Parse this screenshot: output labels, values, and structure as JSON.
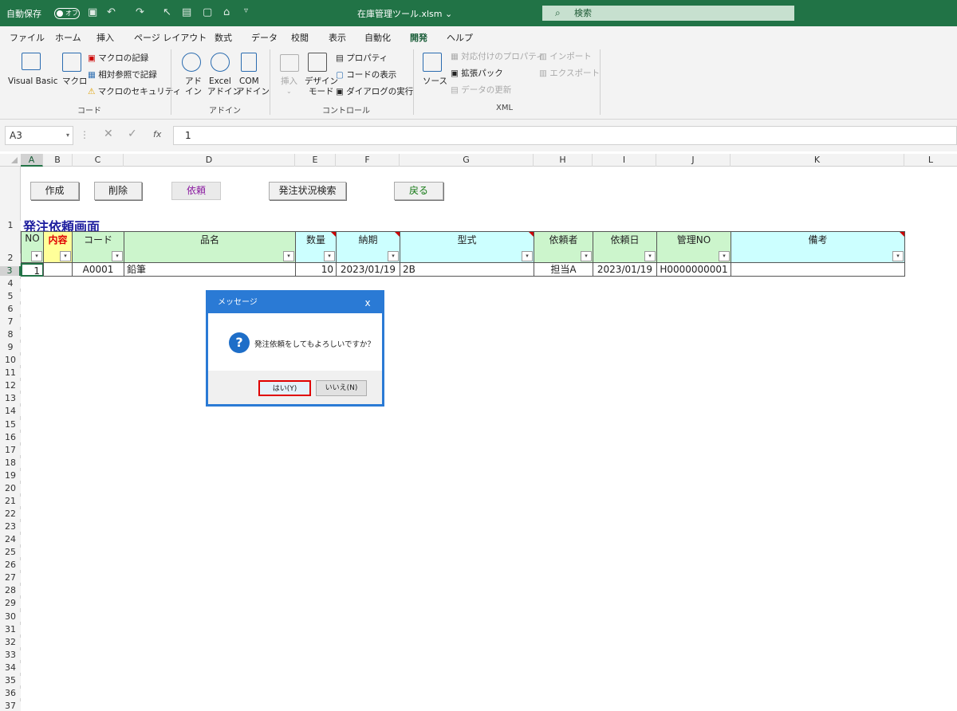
{
  "titlebar": {
    "autosave_label": "自動保存",
    "toggle_state": "オフ",
    "filename": "在庫管理ツール.xlsm",
    "search_placeholder": "検索"
  },
  "menu": [
    "ファイル",
    "ホーム",
    "挿入",
    "ページ レイアウト",
    "数式",
    "データ",
    "校閲",
    "表示",
    "自動化",
    "開発",
    "ヘルプ"
  ],
  "ribbon": {
    "code": {
      "visual_basic": "Visual Basic",
      "macro": "マクロ",
      "record_macro": "マクロの記録",
      "relative_ref": "相対参照で記録",
      "macro_security": "マクロのセキュリティ",
      "group": "コード"
    },
    "addins": {
      "addin_top": "アド",
      "addin_bottom": "イン",
      "excel_top": "Excel",
      "excel_bottom": "アドイン",
      "com_top": "COM",
      "com_bottom": "アドイン",
      "group": "アドイン"
    },
    "controls": {
      "insert": "挿入",
      "design_top": "デザイン",
      "design_bottom": "モード",
      "properties": "プロパティ",
      "view_code": "コードの表示",
      "run_dialog": "ダイアログの実行",
      "group": "コントロール"
    },
    "xml": {
      "source": "ソース",
      "map_props": "対応付けのプロパティ",
      "ext_pack": "拡張パック",
      "refresh": "データの更新",
      "import": "インポート",
      "export": "エクスポート",
      "group": "XML"
    }
  },
  "formula_bar": {
    "name_box": "A3",
    "fx": "fx",
    "value": "1"
  },
  "columns": [
    "A",
    "B",
    "C",
    "D",
    "E",
    "F",
    "G",
    "H",
    "I",
    "J",
    "K",
    "L"
  ],
  "rows": [
    "1",
    "2",
    "3",
    "4",
    "5",
    "6",
    "7",
    "8",
    "9",
    "10",
    "11",
    "12",
    "13",
    "14",
    "15",
    "16",
    "17",
    "18",
    "19",
    "20",
    "21",
    "22",
    "23",
    "24",
    "25",
    "26",
    "27",
    "28",
    "29",
    "30",
    "31",
    "32",
    "33",
    "34",
    "35",
    "36",
    "37"
  ],
  "sheet_buttons": {
    "create": "作成",
    "delete": "削除",
    "request": "依頼",
    "status_search": "発注状況検索",
    "back": "戻る"
  },
  "sheet_title": "発注依頼画面",
  "headers": {
    "no": "NO",
    "content": "内容",
    "code": "コード",
    "item": "品名",
    "qty": "数量",
    "due": "納期",
    "model": "型式",
    "requester": "依頼者",
    "req_date": "依頼日",
    "mgmt_no": "管理NO",
    "remarks": "備考"
  },
  "filter_glyph": "▾",
  "row3": {
    "no": "1",
    "content": "",
    "code": "A0001",
    "item": "鉛筆",
    "qty": "10",
    "due": "2023/01/19",
    "model": "2B",
    "requester": "担当A",
    "req_date": "2023/01/19",
    "mgmt_no": "H0000000001",
    "remarks": ""
  },
  "dialog": {
    "title": "メッセージ",
    "close": "x",
    "icon": "?",
    "message": "発注依頼をしてもよろしいですか？",
    "yes": "はい(Y)",
    "no": "いいえ(N)"
  },
  "colors": {
    "excel_green": "#217346",
    "dialog_blue": "#2a7ad5",
    "header_green": "#ccf5cc",
    "header_cyan": "#ccffff",
    "header_yellow": "#ffff99",
    "highlight_red": "#e00000",
    "title_blue": "#1f1f9f"
  }
}
